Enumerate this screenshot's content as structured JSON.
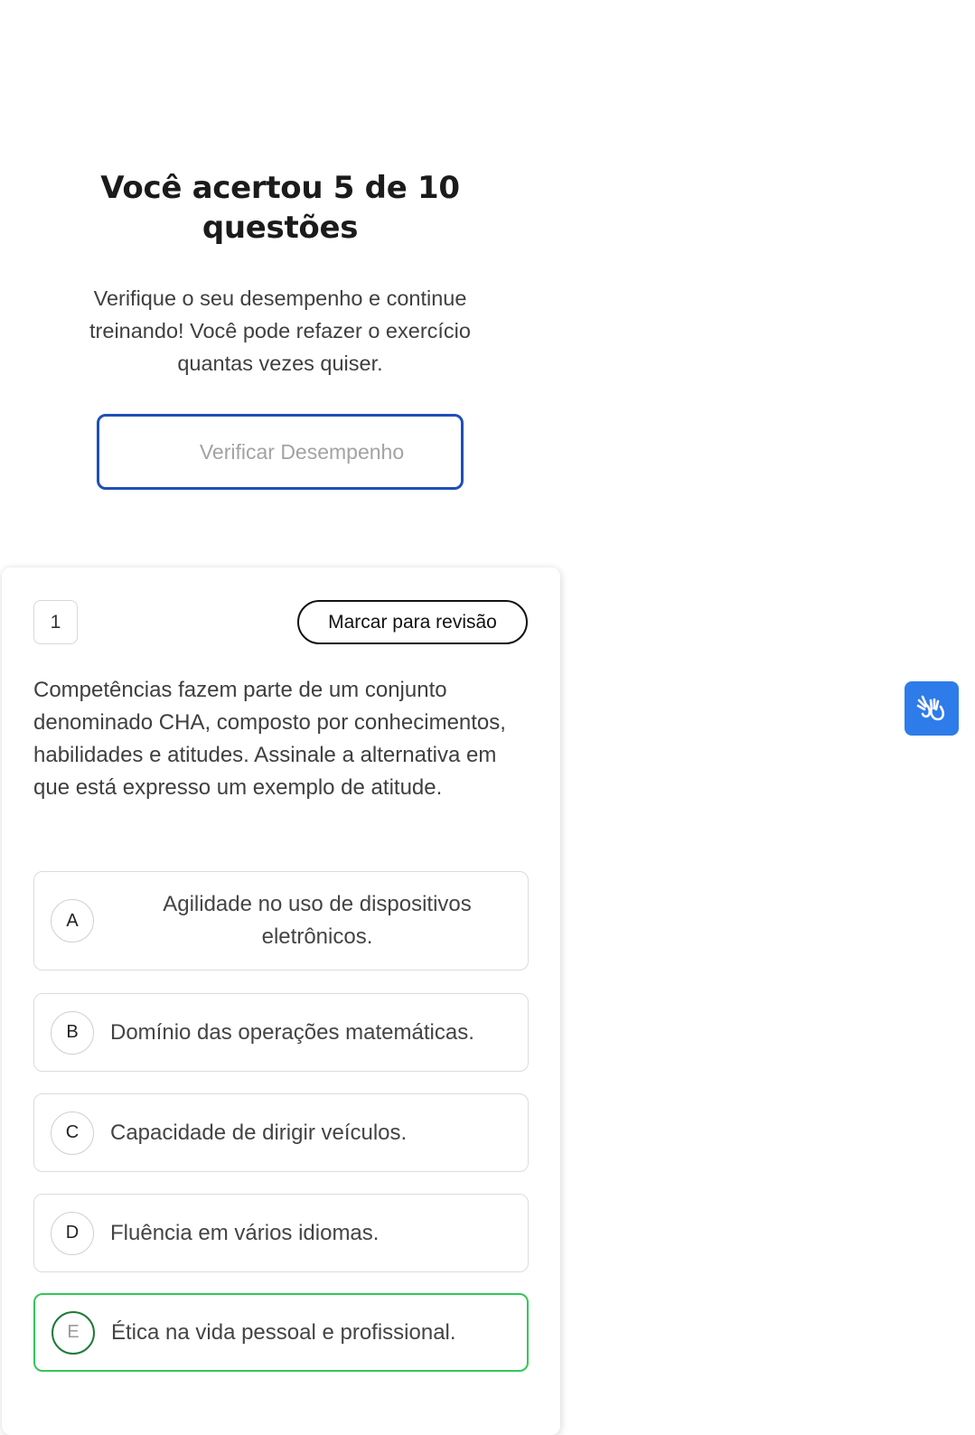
{
  "summary": {
    "title": "Você acertou 5 de 10 questões",
    "subtitle": "Verifique o seu desempenho e continue treinando! Você pode refazer o exercício quantas vezes quiser.",
    "button_label": "Verificar Desempenho"
  },
  "question": {
    "number": "1",
    "review_label": "Marcar para revisão",
    "text": "Competências fazem parte de um conjunto denominado CHA, composto por conhecimentos, habilidades e atitudes. Assinale a alternativa em que está expresso um exemplo de atitude.",
    "options": [
      {
        "letter": "A",
        "text": "Agilidade no uso de dispositivos eletrônicos."
      },
      {
        "letter": "B",
        "text": "Domínio das operações matemáticas."
      },
      {
        "letter": "C",
        "text": "Capacidade de dirigir veículos."
      },
      {
        "letter": "D",
        "text": "Fluência em vários idiomas."
      },
      {
        "letter": "E",
        "text": "Ética na vida pessoal e profissional.",
        "status": "correct"
      }
    ]
  },
  "accessibility": {
    "libras_icon": "sign-language-icon"
  },
  "colors": {
    "primary_border": "#1f4fb8",
    "correct": "#34c759",
    "libras_bg": "#2e7bea"
  }
}
